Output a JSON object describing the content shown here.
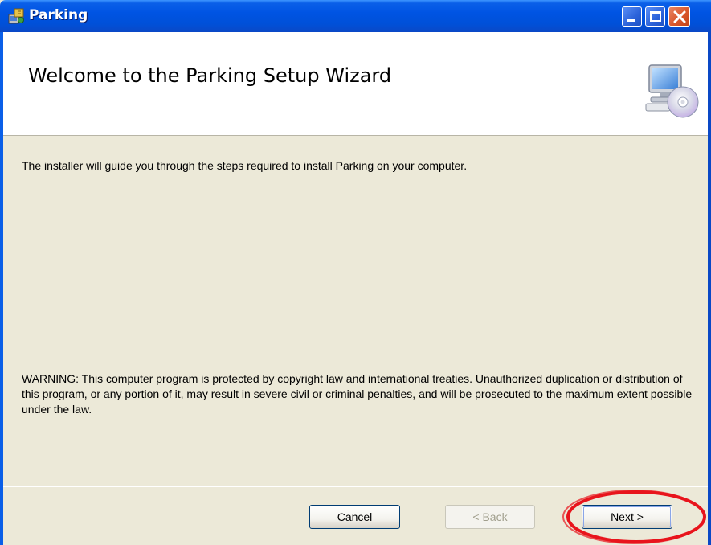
{
  "window": {
    "title": "Parking",
    "accent_color": "#0054e3",
    "icons": [
      "installer-app-icon",
      "minimize-icon",
      "maximize-icon",
      "close-icon"
    ]
  },
  "header": {
    "title": "Welcome to the Parking Setup Wizard",
    "icon": "computer-cd-icon"
  },
  "body": {
    "intro": "The installer will guide you through the steps required to install Parking on your computer.",
    "warning": "WARNING: This computer program is protected by copyright law and international treaties. Unauthorized duplication or distribution of this program, or any portion of it, may result in severe civil or criminal penalties, and will be prosecuted to the maximum extent possible under the law."
  },
  "buttons": {
    "cancel": "Cancel",
    "back": "< Back",
    "next": "Next >"
  },
  "annotation": {
    "shape": "ellipse",
    "color": "#e8141c",
    "target": "next-button"
  }
}
